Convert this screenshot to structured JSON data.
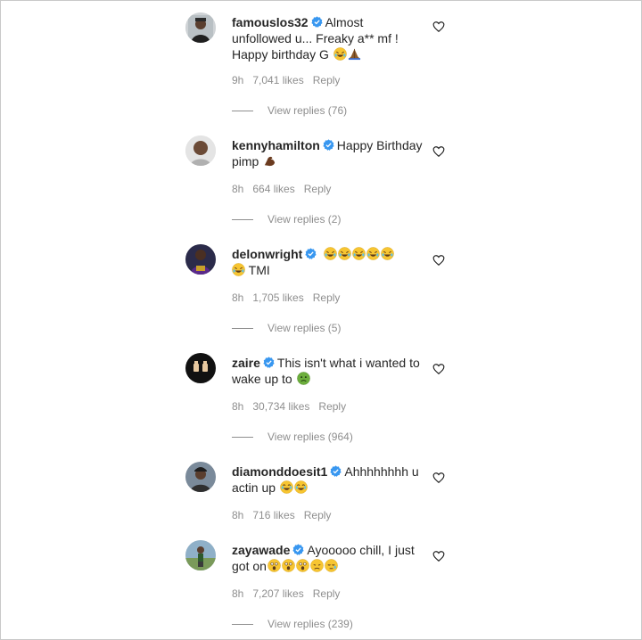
{
  "comments": [
    {
      "username": "famouslos32",
      "verified": true,
      "lines": [
        "Almost",
        "unfollowed u... Freaky a** mf !",
        "Happy birthday G"
      ],
      "emojis": [
        "rofl-emoji",
        "folded-hands-emoji"
      ],
      "time": "9h",
      "likes": "7,041 likes",
      "reply": "Reply",
      "view_replies": "View replies (76)"
    },
    {
      "username": "kennyhamilton",
      "verified": true,
      "lines": [
        "Happy Birthday",
        "pimp"
      ],
      "emojis": [
        "flexed-biceps-emoji"
      ],
      "time": "8h",
      "likes": "664 likes",
      "reply": "Reply",
      "view_replies": "View replies (2)"
    },
    {
      "username": "delonwright",
      "verified": true,
      "lines": [
        "TMI"
      ],
      "emojis": [
        "rofl-emoji",
        "rofl-emoji",
        "rofl-emoji",
        "rofl-emoji",
        "rofl-emoji",
        "rofl-emoji"
      ],
      "time": "8h",
      "likes": "1,705 likes",
      "reply": "Reply",
      "view_replies": "View replies (5)"
    },
    {
      "username": "zaire",
      "verified": true,
      "lines": [
        "This isn't what i wanted to",
        "wake up to"
      ],
      "emojis": [
        "nauseated-face-emoji"
      ],
      "time": "8h",
      "likes": "30,734 likes",
      "reply": "Reply",
      "view_replies": "View replies (964)"
    },
    {
      "username": "diamonddoesit1",
      "verified": true,
      "lines": [
        "Ahhhhhhhh u",
        "actin up"
      ],
      "emojis": [
        "tears-of-joy-emoji",
        "tears-of-joy-emoji"
      ],
      "time": "8h",
      "likes": "716 likes",
      "reply": "Reply",
      "view_replies": ""
    },
    {
      "username": "zayawade",
      "verified": true,
      "lines": [
        "Ayooooo chill, I just",
        "got on"
      ],
      "emojis": [
        "astonished-face-emoji",
        "astonished-face-emoji",
        "astonished-face-emoji",
        "disappointed-face-emoji",
        "sleepy-face-emoji"
      ],
      "time": "8h",
      "likes": "7,207 likes",
      "reply": "Reply",
      "view_replies": "View replies (239)"
    }
  ],
  "colors": {
    "text": "#262626",
    "meta": "#8e8e8e",
    "verified": "#3897f0",
    "emoji_yellow": "#f7c531",
    "emoji_green": "#6cae3c"
  }
}
